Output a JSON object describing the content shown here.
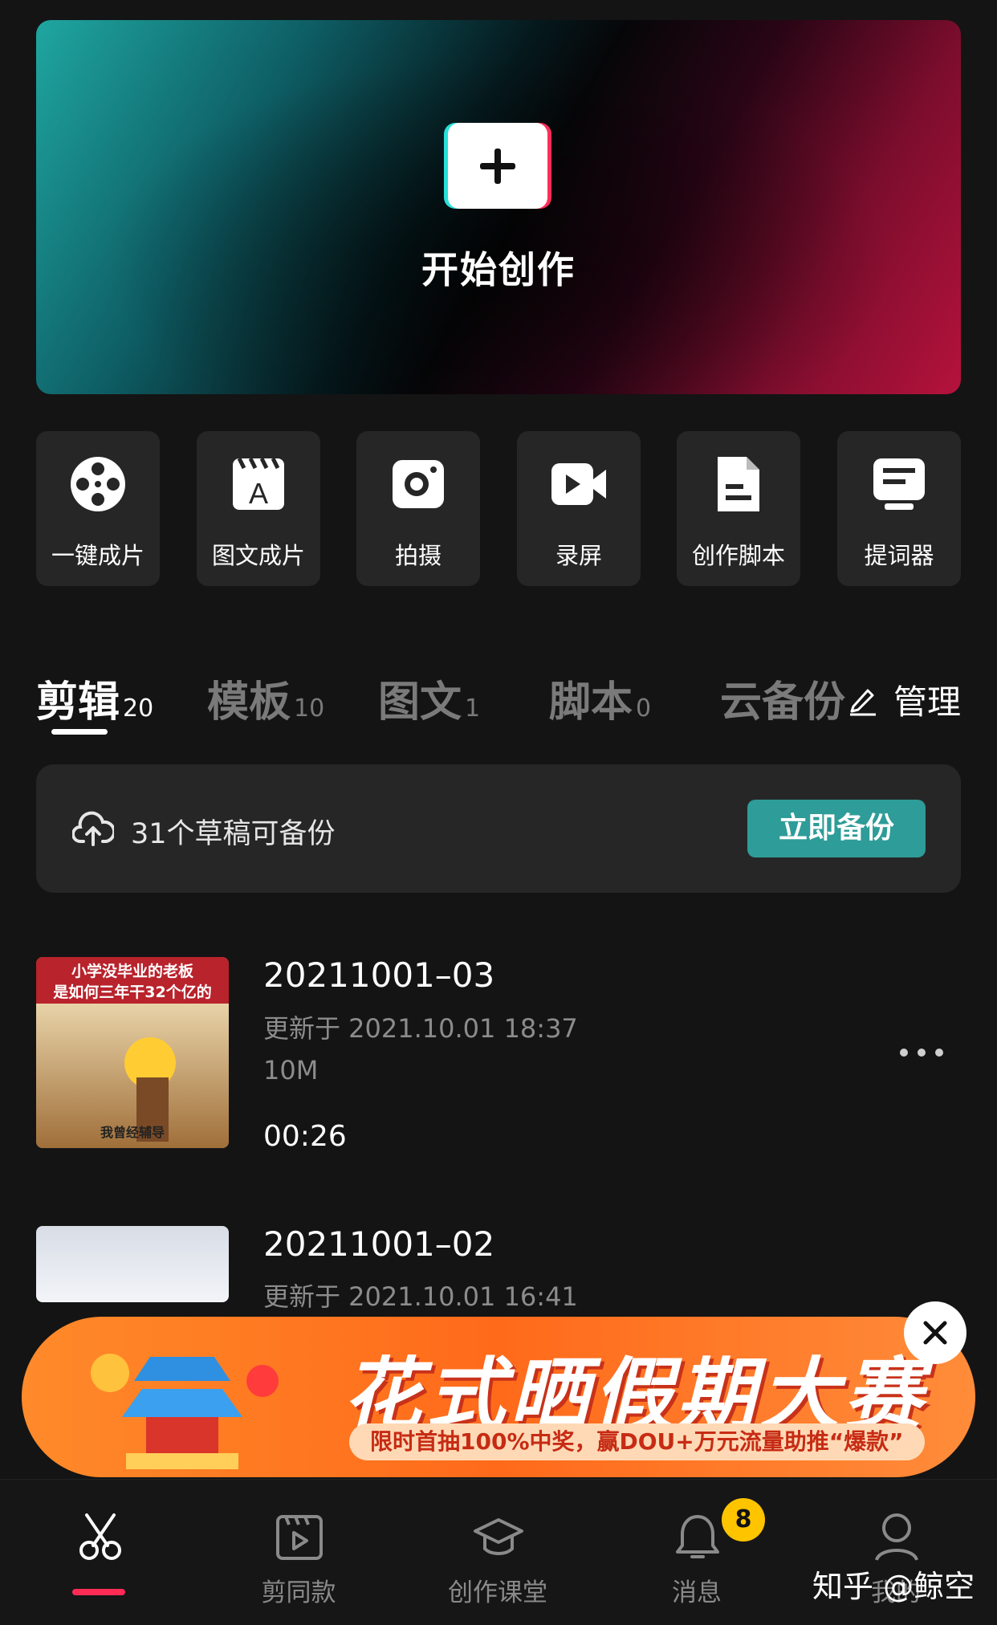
{
  "hero": {
    "title": "开始创作"
  },
  "quick_actions": [
    {
      "label": "一键成片",
      "icon": "film-reel-icon"
    },
    {
      "label": "图文成片",
      "icon": "clapper-text-icon"
    },
    {
      "label": "拍摄",
      "icon": "camera-icon"
    },
    {
      "label": "录屏",
      "icon": "video-record-icon"
    },
    {
      "label": "创作脚本",
      "icon": "script-doc-icon"
    },
    {
      "label": "提词器",
      "icon": "teleprompter-icon"
    }
  ],
  "tabs": [
    {
      "label": "剪辑",
      "count": "20",
      "active": true
    },
    {
      "label": "模板",
      "count": "10"
    },
    {
      "label": "图文",
      "count": "1"
    },
    {
      "label": "脚本",
      "count": "0"
    },
    {
      "label": "云备份",
      "count": ""
    }
  ],
  "manage_label": "管理",
  "backup": {
    "text": "31个草稿可备份",
    "button": "立即备份"
  },
  "drafts": [
    {
      "title": "20211001–03",
      "updated": "更新于 2021.10.01 18:37",
      "size": "10M",
      "duration": "00:26",
      "thumb_caption_1": "小学没毕业的老板",
      "thumb_caption_2": "是如何三年干32个亿的",
      "thumb_footer": "我曾经辅导"
    },
    {
      "title": "20211001–02",
      "updated": "更新于 2021.10.01 16:41"
    }
  ],
  "promo": {
    "title": "花式晒假期大赛",
    "subtitle": "限时首抽100%中奖，赢DOU+万元流量助推“爆款”"
  },
  "bottom_nav": [
    {
      "label": "",
      "icon": "scissors-icon",
      "active": true
    },
    {
      "label": "剪同款",
      "icon": "template-clapper-icon"
    },
    {
      "label": "创作课堂",
      "icon": "graduation-cap-icon"
    },
    {
      "label": "消息",
      "icon": "bell-icon",
      "badge": "8"
    },
    {
      "label": "我的",
      "icon": "person-icon"
    }
  ],
  "watermark": "知乎 @鲸空",
  "colors": {
    "accent_teal": "#2e9c98",
    "accent_red": "#fe2c55",
    "badge_yellow": "#ffc400",
    "background": "#141414"
  }
}
